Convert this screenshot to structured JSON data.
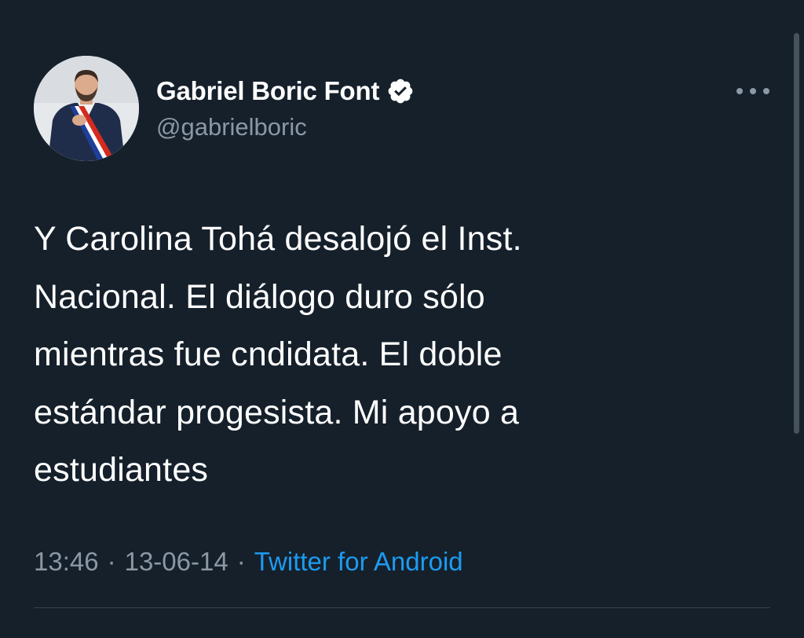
{
  "tweet": {
    "author": {
      "display_name": "Gabriel Boric Font",
      "handle": "@gabrielboric",
      "verified": true
    },
    "text_lines": [
      "Y Carolina Tohá desalojó el Inst.",
      "Nacional. El diálogo duro sólo",
      "mientras fue cndidata. El doble",
      "estándar progesista. Mi apoyo a",
      "estudiantes"
    ],
    "time": "13:46",
    "date": "13-06-14",
    "separator": "·",
    "source": "Twitter for Android"
  },
  "icons": {
    "verified": "verified-badge-icon",
    "more": "more-options-icon"
  },
  "colors": {
    "background": "#15202b",
    "text": "#ffffff",
    "secondary_text": "#8b98a5",
    "link": "#1d9bf0",
    "divider": "#38444d"
  }
}
